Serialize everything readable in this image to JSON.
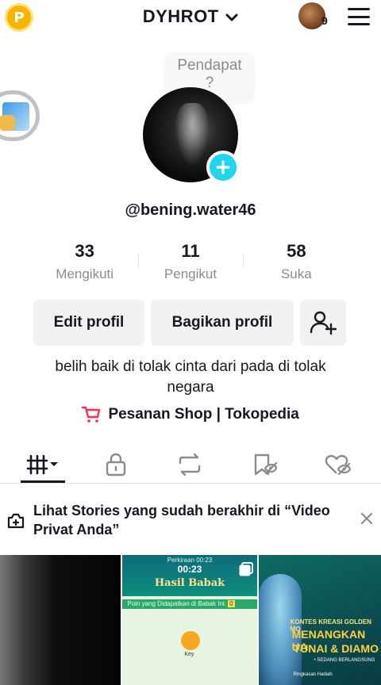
{
  "header": {
    "points_badge_letter": "P",
    "username": "DYHROT",
    "friends_count": "9"
  },
  "note": {
    "line1": "Pendapat",
    "line2": "?"
  },
  "profile": {
    "handle": "@bening.water46",
    "stats": [
      {
        "value": "33",
        "label": "Mengikuti"
      },
      {
        "value": "11",
        "label": "Pengikut"
      },
      {
        "value": "58",
        "label": "Suka"
      }
    ],
    "edit_label": "Edit profil",
    "share_label": "Bagikan profil",
    "bio": "belih baik di tolak cinta dari pada di tolak negara",
    "shop_label": "Pesanan Shop | Tokopedia"
  },
  "tabs": [
    {
      "icon": "videos-grid-icon",
      "active": true
    },
    {
      "icon": "lock-icon"
    },
    {
      "icon": "repost-icon"
    },
    {
      "icon": "bookmark-icon"
    },
    {
      "icon": "liked-hidden-icon"
    }
  ],
  "banner": {
    "text": "Lihat Stories yang sudah berakhir di “Video Privat Anda”"
  },
  "videos": {
    "v2": {
      "timer_label": "Perkiraan 00:23",
      "timer": "00:23",
      "title": "Hasil Babak",
      "ribbon_text": "Poin yang Didapatkan di Babak Ini:",
      "ribbon_value": "0",
      "key_label": "Key"
    },
    "v3": {
      "head": "KONTES KREASI GOLDEN MO",
      "line1": "MENANGKAN UA",
      "line2": "TUNAI & DIAMO",
      "sub": "• SEDANG BERLANGSUNG",
      "sub2": "Ringkasan Hadiah"
    }
  },
  "colors": {
    "accent_cyan": "#20d5ec",
    "shop_red": "#fe2c55",
    "text_primary": "#161823",
    "text_secondary": "#8a8b91",
    "button_bg": "#f1f1f2",
    "points_gold": "#f7b500"
  }
}
